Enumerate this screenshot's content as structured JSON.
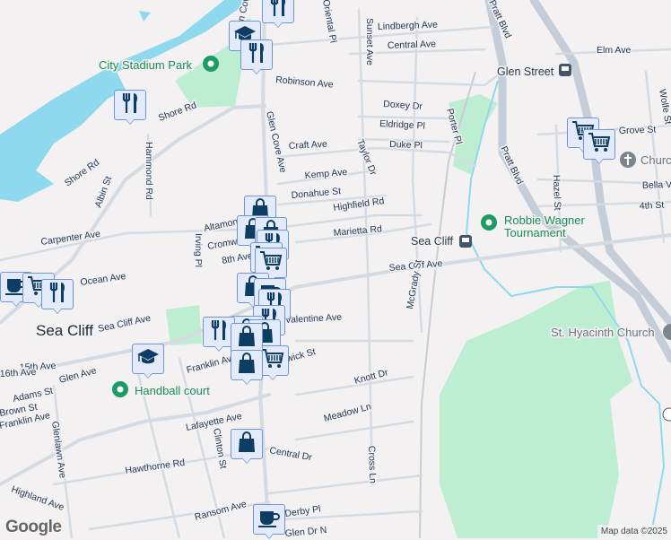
{
  "map": {
    "town_label": "Sea Cliff",
    "places": {
      "city_stadium_park": "City Stadium Park",
      "robbie_wagner": [
        "Robbie Wagner",
        "Tournament"
      ],
      "handball_court": "Handball court",
      "church": "Church",
      "st_hyacinth": "St. Hyacinth Church",
      "glen_street_station": "Glen Street",
      "sea_cliff_station": "Sea Cliff"
    },
    "streets": [
      "Robinson Ave",
      "Lindbergh Ave",
      "Central Ave",
      "Elm Ave",
      "Sunset Ave",
      "Doxey Dr",
      "Eldridge Pl",
      "Duke Pl",
      "Porter Pl",
      "Taylor Dr",
      "Kemp Ave",
      "Donahue St",
      "Highfield Rd",
      "Marietta Rd",
      "Craft Ave",
      "Glen Cove Ave",
      "Shore Rd",
      "Shore Rd",
      "Albin St",
      "Hammond Rd",
      "Carpenter Ave",
      "Altamont",
      "Cromwell",
      "8th Ave",
      "Irving Pl",
      "Sea Cliff Ave",
      "Sea Cliff Ave",
      "Pratt Blvd",
      "Pratt Blvd",
      "Hazel St",
      "Grove St",
      "Bella Vista",
      "4th St",
      "Wolfe St",
      "McGrady St",
      "Knott Dr",
      "Meadow Ln",
      "Cross Ln",
      "Valentine Ave",
      "Chadwick St",
      "Franklin Ave",
      "15th Ave",
      "16th Ave",
      "Glen Ave",
      "Adams St",
      "Brown St",
      "Franklin Ave",
      "Lafayette Ave",
      "Clinton St",
      "Glenlawn Ave",
      "Central Dr",
      "Hawthorne Rd",
      "Highland Ave",
      "Ransom Ave",
      "Derby Pl",
      "Glen Dr N",
      "Glen Cove Ave",
      "Ocean Ave",
      "Oriental Pl"
    ],
    "markers": [
      "restaurant-icon",
      "education-icon",
      "restaurant-icon",
      "restaurant-icon",
      "shopping-icon",
      "shopping-icon",
      "shopping-icon",
      "restaurant-icon",
      "grocery-icon",
      "grocery-icon",
      "shopping-icon",
      "cafe-icon",
      "restaurant-icon",
      "restaurant-icon",
      "shopping-icon",
      "shopping-icon",
      "grocery-icon",
      "cafe-icon",
      "grocery-icon",
      "restaurant-icon",
      "restaurant-icon",
      "shopping-icon",
      "education-icon",
      "shopping-icon",
      "shopping-icon",
      "cafe-icon",
      "grocery-icon",
      "grocery-icon"
    ],
    "google_logo": "Google",
    "attribution": "Map data ©2025"
  },
  "colors": {
    "park": "#bdeed1",
    "water": "#8fd9ef",
    "road": "#d5dbe2",
    "marker_bg": "#e3ebfb",
    "marker_icon": "#0e3d63",
    "poi_green": "#1a8c5a"
  }
}
